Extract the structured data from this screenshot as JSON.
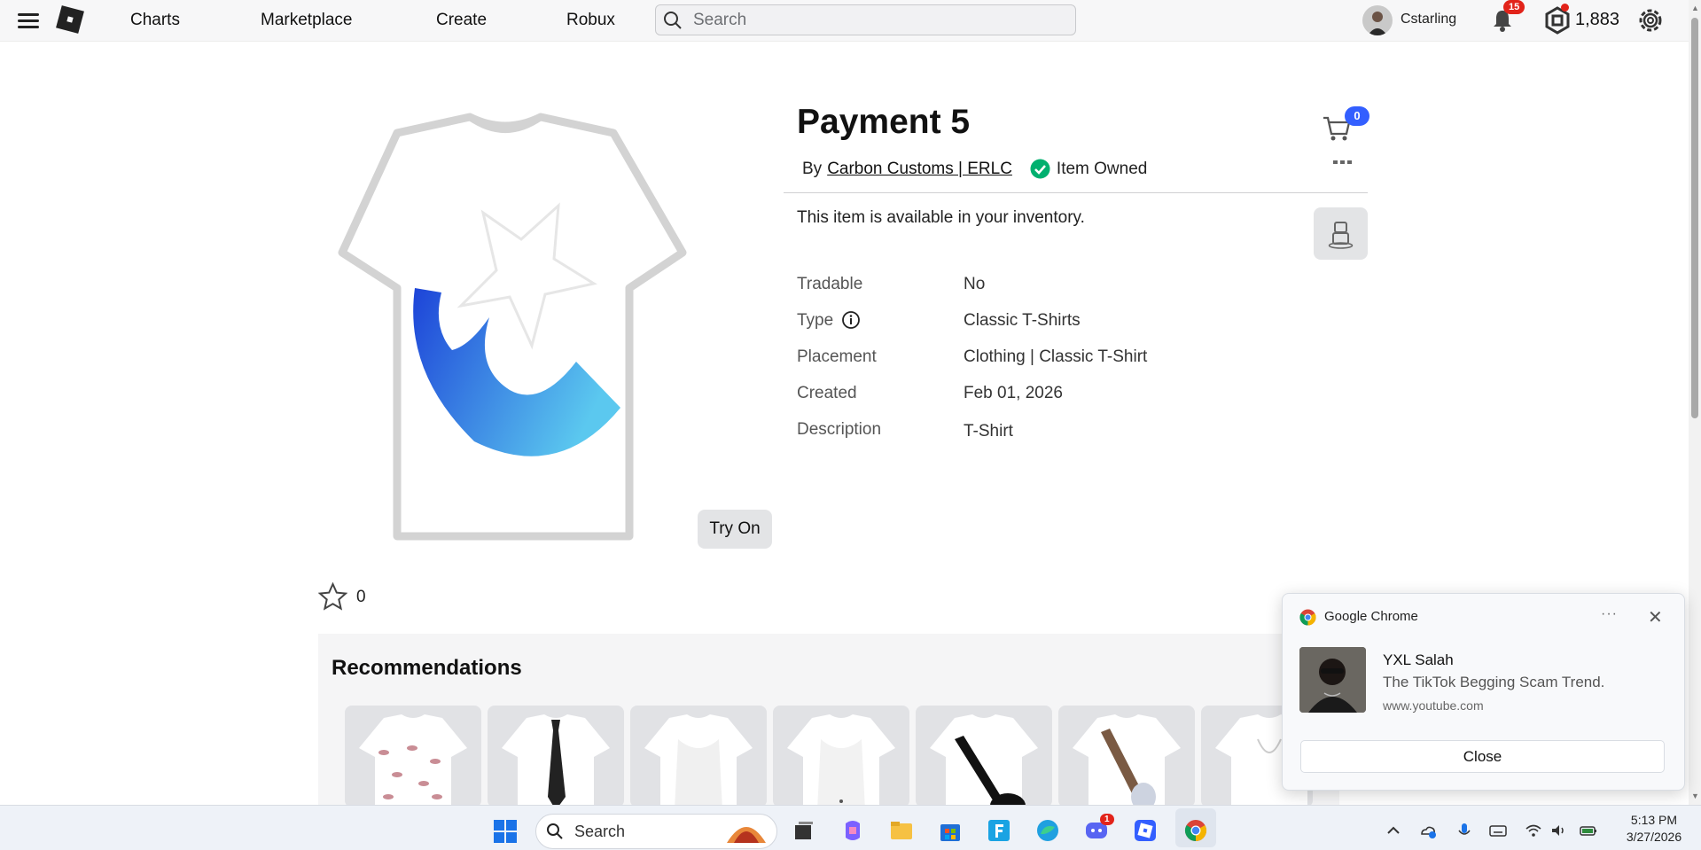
{
  "nav": {
    "items": [
      {
        "label": "Charts"
      },
      {
        "label": "Marketplace"
      },
      {
        "label": "Create"
      },
      {
        "label": "Robux"
      }
    ],
    "search_placeholder": "Search",
    "username": "Cstarling",
    "notification_count": "15",
    "robux_balance": "1,883"
  },
  "item": {
    "title": "Payment 5",
    "by_label": "By",
    "creator": "Carbon Customs | ERLC",
    "owned_label": "Item Owned",
    "cart_count": "0",
    "availability": "This item is available in your inventory.",
    "try_on_label": "Try On",
    "favorite_count": "0",
    "details": [
      {
        "label": "Tradable",
        "value": "No"
      },
      {
        "label": "Type",
        "value": "Classic T-Shirts"
      },
      {
        "label": "Placement",
        "value": "Clothing | Classic T-Shirt"
      },
      {
        "label": "Created",
        "value": "Feb 01, 2026"
      },
      {
        "label": "Description",
        "value": "T-Shirt"
      }
    ]
  },
  "recommendations": {
    "title": "Recommendations"
  },
  "notification_toast": {
    "app": "Google Chrome",
    "title": "YXL Salah",
    "body": "The TikTok Begging Scam Trend.",
    "url": "www.youtube.com",
    "close_label": "Close"
  },
  "taskbar": {
    "search_label": "Search",
    "discord_badge": "1",
    "time": "5:13 PM",
    "date": "3/27/2026"
  },
  "icons": {
    "menu": "hamburger-icon",
    "logo": "roblox-logo",
    "search": "search-icon",
    "bell": "bell-icon",
    "robux": "robux-icon",
    "settings": "gear-icon",
    "cart": "cart-icon",
    "more": "more-dots-icon",
    "owned": "check-circle-icon",
    "info": "info-icon",
    "favorite": "star-icon",
    "avatar_preview": "avatar-icon"
  },
  "colors": {
    "accent_blue": "#335fff",
    "badge_red": "#e2231a",
    "owned_green": "#00b06f"
  }
}
